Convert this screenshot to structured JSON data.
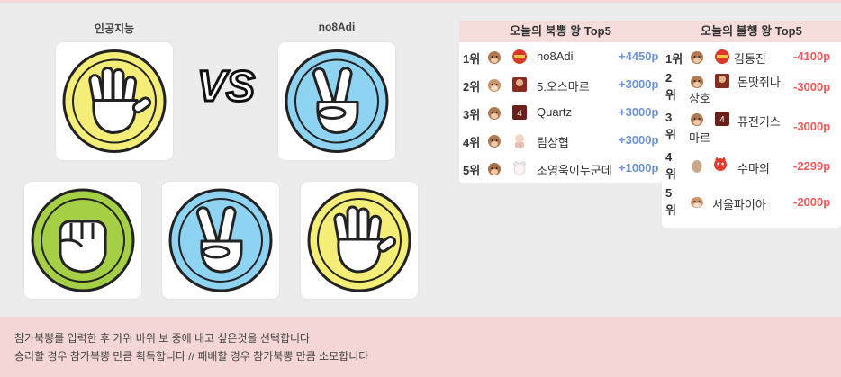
{
  "players": {
    "left": "인공지능",
    "right": "no8Adi"
  },
  "vs_text": "VS",
  "choices": [
    {
      "icon": "rock-icon",
      "color": "#a5cf45"
    },
    {
      "icon": "scissors-icon",
      "color": "#8fd3f2"
    },
    {
      "icon": "paper-icon",
      "color": "#f4ee78"
    }
  ],
  "board_win": {
    "title": "오늘의 북뽕 왕 Top5",
    "rows": [
      {
        "rank": "1위",
        "name": "no8Adi",
        "points": "+4450p"
      },
      {
        "rank": "2위",
        "name": "5.오스마르",
        "points": "+3000p"
      },
      {
        "rank": "3위",
        "name": "Quartz",
        "points": "+3000p"
      },
      {
        "rank": "4위",
        "name": "림상협",
        "points": "+3000p"
      },
      {
        "rank": "5위",
        "name": "조영욱이누군데",
        "points": "+1000p"
      }
    ]
  },
  "board_lose": {
    "title": "오늘의 불행 왕 Top5",
    "rows": [
      {
        "rank1": "1위",
        "rank2": "",
        "name1": "김동진",
        "name2": "",
        "points": "-4100p"
      },
      {
        "rank1": "2",
        "rank2": "위",
        "name1": "돈땃쥐나",
        "name2": "상호",
        "points": "-3000p"
      },
      {
        "rank1": "3",
        "rank2": "위",
        "name1": "퓨전기스",
        "name2": "마르",
        "points": "-3000p"
      },
      {
        "rank1": "4",
        "rank2": "위",
        "name1": "수마의",
        "name2": "",
        "points": "-2299p"
      },
      {
        "rank1": "5",
        "rank2": "위",
        "name1": "서울파이아",
        "name2": "",
        "points": "-2000p"
      }
    ]
  },
  "footer": {
    "line1": "참가북뽕를 입력한 후 가위 바위 보 중에 내고 싶은것을 선택합니다",
    "line2": "승리할 경우 참가북뽕 만큼 획득합니다 // 패배할 경우 참가북뽕 만큼 소모합니다"
  }
}
